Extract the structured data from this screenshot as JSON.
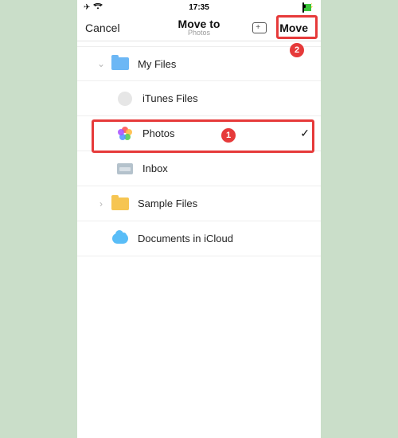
{
  "status": {
    "time": "17:35"
  },
  "nav": {
    "cancel": "Cancel",
    "title": "Move to",
    "subtitle": "Photos",
    "move": "Move"
  },
  "rows": {
    "myfiles": "My Files",
    "itunes": "iTunes Files",
    "photos": "Photos",
    "inbox": "Inbox",
    "sample": "Sample Files",
    "icloud": "Documents in iCloud"
  },
  "annotations": {
    "step1": "1",
    "step2": "2"
  }
}
